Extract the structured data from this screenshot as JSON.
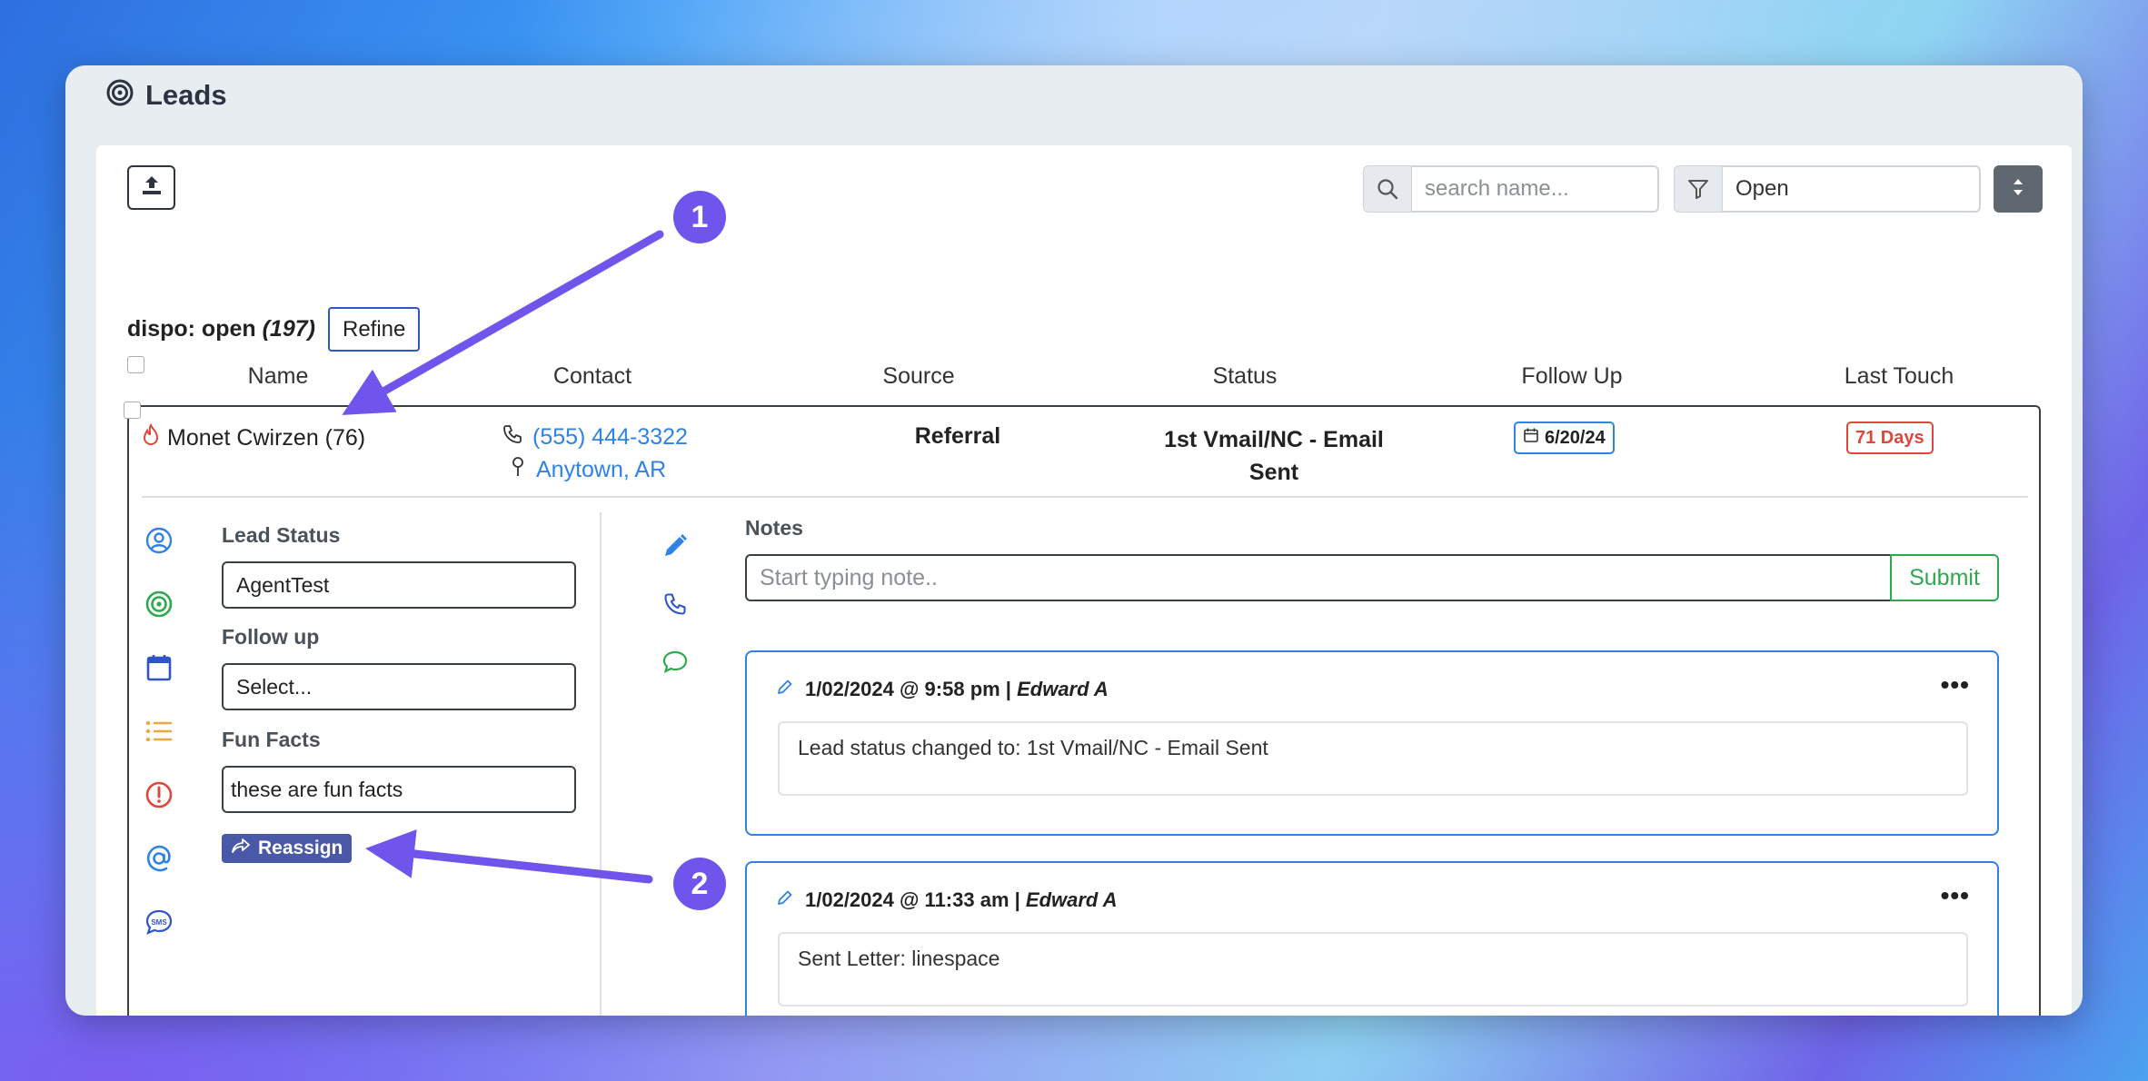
{
  "window": {
    "title": "Leads"
  },
  "toolbar": {
    "search_placeholder": "search name...",
    "filter_value": "Open"
  },
  "dispo": {
    "label": "dispo: open",
    "count": "(197)",
    "refine_label": "Refine"
  },
  "table": {
    "headers": [
      "Name",
      "Contact",
      "Source",
      "Status",
      "Follow Up",
      "Last Touch"
    ]
  },
  "lead": {
    "name": "Monet Cwirzen (76)",
    "phone": "(555) 444-3322",
    "location": "Anytown, AR",
    "source": "Referral",
    "status": "1st Vmail/NC - Email Sent",
    "follow_up": "6/20/24",
    "last_touch": "71 Days"
  },
  "details": {
    "lead_status_label": "Lead Status",
    "lead_status_value": "AgentTest",
    "follow_up_label": "Follow up",
    "follow_up_value": "Select...",
    "fun_facts_label": "Fun Facts",
    "fun_facts_value": "these are fun facts",
    "reassign_label": "Reassign"
  },
  "notes": {
    "label": "Notes",
    "placeholder": "Start typing note..",
    "submit_label": "Submit",
    "items": [
      {
        "meta": "1/02/2024 @ 9:58 pm |",
        "author": "Edward A",
        "body": "Lead status changed to: 1st Vmail/NC - Email Sent"
      },
      {
        "meta": "1/02/2024 @ 11:33 am |",
        "author": "Edward A",
        "body": "Sent Letter: linespace"
      }
    ]
  },
  "callouts": {
    "one": "1",
    "two": "2"
  },
  "colors": {
    "accent_blue": "#2f82e6",
    "danger_red": "#e0473c",
    "success_green": "#2fa84f",
    "callout_purple": "#6f55ec",
    "reassign_indigo": "#4a58a8"
  }
}
